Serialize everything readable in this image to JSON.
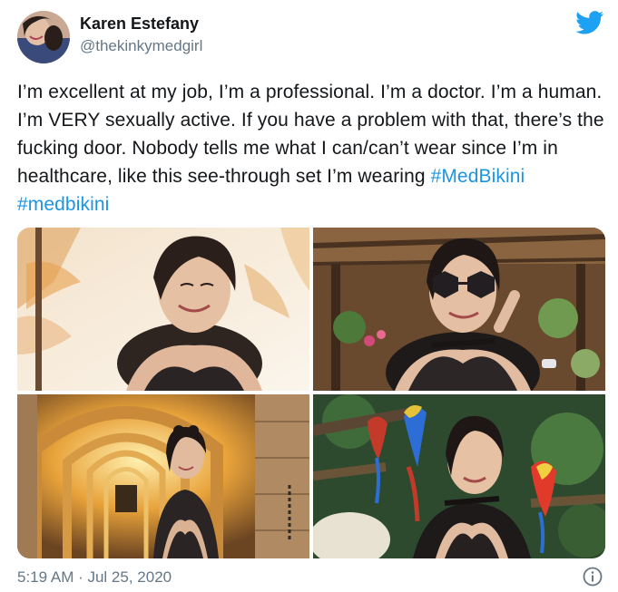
{
  "author": {
    "name": "Karen Estefany",
    "handle": "@thekinkymedgirl"
  },
  "tweet": {
    "text_parts": [
      "I’m excellent at my job, I’m a professional. I’m a doctor. I’m a human. I’m VERY sexually active. If you have a problem with that, there’s the fucking door. Nobody tells me what I can/can’t wear since I’m in healthcare, like this see-through set I’m wearing ",
      "#MedBikini",
      " ",
      "#medbikini"
    ],
    "hashtag_color": "#1b95e0"
  },
  "media": {
    "photos": [
      {
        "description_icon": "photo-woman-palms"
      },
      {
        "description_icon": "photo-woman-sunglasses"
      },
      {
        "description_icon": "photo-woman-tunnel"
      },
      {
        "description_icon": "photo-woman-parrots"
      }
    ]
  },
  "footer": {
    "timestamp": "5:19 AM · Jul 25, 2020"
  },
  "icons": {
    "brand": "twitter-bird-icon",
    "info": "info-icon"
  },
  "colors": {
    "brand_blue": "#1da1f2",
    "secondary_text": "#657786"
  }
}
